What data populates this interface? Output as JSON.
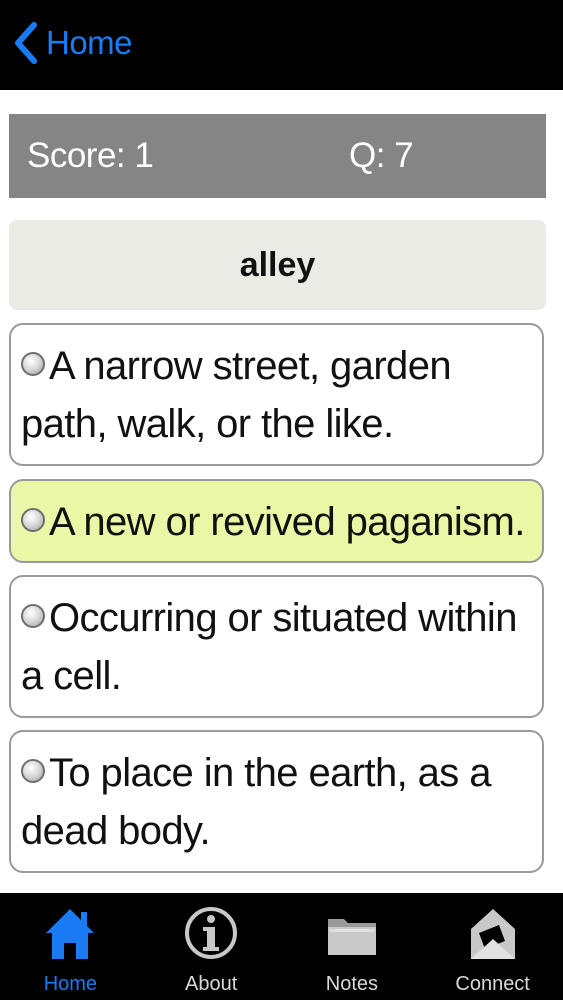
{
  "nav": {
    "back_label": "Home"
  },
  "score": {
    "score_text": "Score: 1",
    "question_text": "Q: 7"
  },
  "question": {
    "word": "alley"
  },
  "options": [
    {
      "text": "A narrow street, garden path, walk, or the like."
    },
    {
      "text": "A new or revived paganism."
    },
    {
      "text": "Occurring or situated within a cell."
    },
    {
      "text": "To place in the earth, as a dead body."
    }
  ],
  "highlighted_option_index": 1,
  "tabs": [
    {
      "label": "Home",
      "icon": "home-icon",
      "active": true
    },
    {
      "label": "About",
      "icon": "info-icon",
      "active": false
    },
    {
      "label": "Notes",
      "icon": "folder-icon",
      "active": false
    },
    {
      "label": "Connect",
      "icon": "envelope-icon",
      "active": false
    }
  ],
  "colors": {
    "accent": "#1a7cf5",
    "score_bar": "#858585",
    "highlight": "#eaf7a6",
    "word_box": "#ebebe6"
  }
}
